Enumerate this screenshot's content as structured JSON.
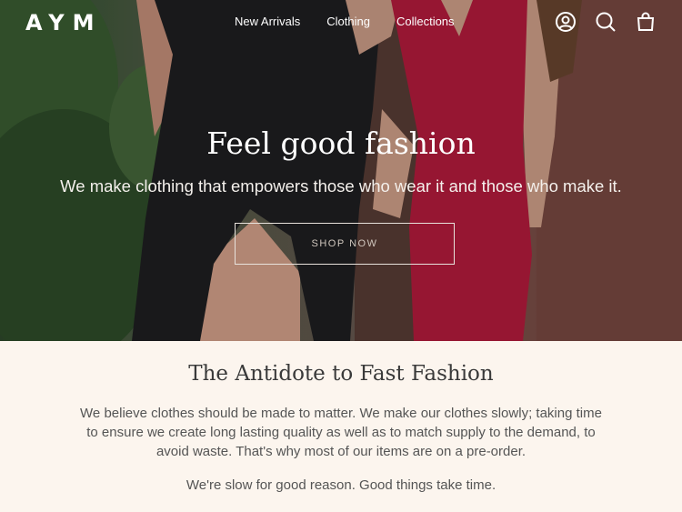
{
  "brand": {
    "logo_text": "AYM"
  },
  "nav": {
    "items": [
      {
        "label": "New Arrivals"
      },
      {
        "label": "Clothing"
      },
      {
        "label": "Collections"
      }
    ]
  },
  "header_icons": [
    "account-icon",
    "search-icon",
    "cart-icon"
  ],
  "hero": {
    "title": "Feel good fashion",
    "subtitle": "We make clothing that empowers those who wear it and those who make it.",
    "cta_label": "SHOP NOW"
  },
  "info": {
    "title": "The Antidote to Fast Fashion",
    "body": "We believe clothes should be made to matter. We make our clothes slowly; taking time to ensure we create long lasting quality as well as to match supply to the demand, to avoid waste. That's why most of our items are on a pre-order.",
    "note": "We're slow for good reason. Good things take time."
  },
  "colors": {
    "page_background": "#fcf5ee",
    "text_dark": "#3a3a3a",
    "text_body": "#555555",
    "black_dress": "#1f1f22",
    "red_dress": "#b81c3e"
  }
}
